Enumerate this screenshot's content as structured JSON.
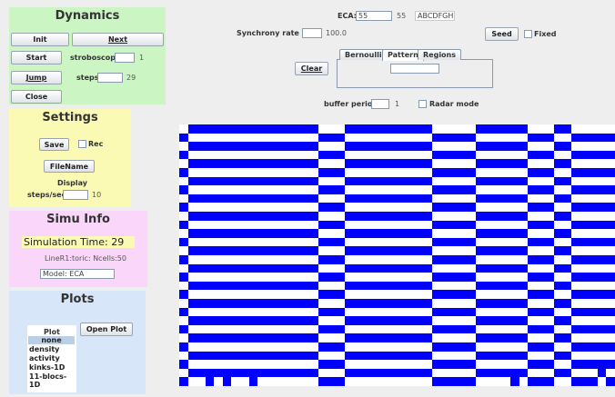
{
  "dynamics": {
    "title": "Dynamics",
    "init_label": "Init",
    "next_label": "Next",
    "start_label": "Start",
    "stroboscope_label": "stroboscope",
    "stroboscope_value": "1",
    "jump_label": "Jump",
    "steps_label": "steps",
    "steps_value": "29",
    "close_label": "Close"
  },
  "settings": {
    "title": "Settings",
    "save_label": "Save",
    "rec_label": "Rec",
    "filename_label": "FileName",
    "display_label": "Display",
    "steps_sec_label": "steps/sec",
    "steps_sec_value": "10"
  },
  "simu_info": {
    "title": "Simu Info",
    "simulation_time": "Simulation Time: 29",
    "line_info": "LineR1:toric: Ncells:50",
    "model": "Model: ECA"
  },
  "plots": {
    "title": "Plots",
    "list_header": "Plot",
    "items": [
      "none",
      "density",
      "activity",
      "kinks-1D",
      "11-blocs-1D"
    ],
    "selected": "none",
    "open_plot_label": "Open Plot"
  },
  "controls": {
    "eca_label": "ECA:",
    "eca_value": "55",
    "eca_code": "55",
    "eca_bits": "ABCDFGH",
    "synchrony_label": "Synchrony rate (%)",
    "synchrony_value": "",
    "synchrony_display": "100.0",
    "seed_label": "Seed",
    "fixed_label": "Fixed",
    "clear_label": "Clear",
    "tabs": [
      "Bernoulli",
      "Pattern",
      "Regions"
    ],
    "active_tab": "Pattern",
    "pattern_value": "",
    "buffer_label": "buffer period",
    "buffer_value": "",
    "buffer_display": "1",
    "radar_label": "Radar mode"
  },
  "grid": {
    "color_on": "#0000ff",
    "color_off": "#ffffff",
    "rows": 30,
    "cols": 50,
    "bottom_row_on_cols": [
      0,
      3,
      5,
      8,
      16,
      17,
      18,
      29,
      30,
      31,
      32,
      33,
      38,
      40,
      41,
      42,
      45,
      46,
      47,
      49
    ]
  }
}
